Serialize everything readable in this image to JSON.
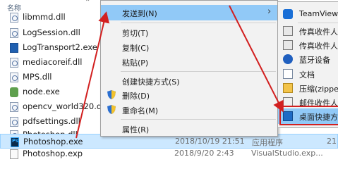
{
  "explorer": {
    "column_name": "名称",
    "files": [
      {
        "name": "libmmd.dll",
        "icon": "dll-icon",
        "date": "",
        "type": "",
        "size": ""
      },
      {
        "name": "LogSession.dll",
        "icon": "dll-icon",
        "date": "",
        "type": "",
        "size": ""
      },
      {
        "name": "LogTransport2.exe",
        "icon": "exe-icon",
        "date": "",
        "type": "",
        "size": ""
      },
      {
        "name": "mediacoreif.dll",
        "icon": "dll-icon",
        "date": "",
        "type": "",
        "size": ""
      },
      {
        "name": "MPS.dll",
        "icon": "dll-icon",
        "date": "",
        "type": "",
        "size": ""
      },
      {
        "name": "node.exe",
        "icon": "node-icon",
        "date": "",
        "type": "",
        "size": ""
      },
      {
        "name": "opencv_world320.dll",
        "icon": "dll-icon",
        "date": "",
        "type": "",
        "size": ""
      },
      {
        "name": "pdfsettings.dll",
        "icon": "dll-icon",
        "date": "",
        "type": "",
        "size": ""
      },
      {
        "name": "Photoshop.dll",
        "icon": "dll-icon",
        "date": "",
        "type": "",
        "size": ""
      },
      {
        "name": "Photoshop.exe",
        "icon": "photoshop-icon",
        "date": "2018/10/19 21:51",
        "type": "应用程序",
        "size": "21"
      },
      {
        "name": "Photoshop.exp",
        "icon": "exp-file-icon",
        "date": "2018/9/20 2:43",
        "type": "VisualStudio.exp...",
        "size": ""
      }
    ]
  },
  "context_menu": {
    "items": [
      {
        "label": "发送到(N)",
        "has_submenu": true,
        "shield": false
      },
      {
        "label": "剪切(T)",
        "has_submenu": false,
        "shield": false
      },
      {
        "label": "复制(C)",
        "has_submenu": false,
        "shield": false
      },
      {
        "label": "粘贴(P)",
        "has_submenu": false,
        "shield": false
      },
      {
        "label": "创建快捷方式(S)",
        "has_submenu": false,
        "shield": false
      },
      {
        "label": "删除(D)",
        "has_submenu": false,
        "shield": true
      },
      {
        "label": "重命名(M)",
        "has_submenu": false,
        "shield": true
      },
      {
        "label": "属性(R)",
        "has_submenu": false,
        "shield": false
      }
    ]
  },
  "send_to_menu": {
    "items": [
      {
        "label": "TeamViewer",
        "icon": "teamviewer-icon"
      },
      {
        "label": "传真收件人",
        "icon": "fax-icon"
      },
      {
        "label": "传真收件人",
        "icon": "fax-icon"
      },
      {
        "label": "蓝牙设备",
        "icon": "bluetooth-icon"
      },
      {
        "label": "文档",
        "icon": "documents-icon"
      },
      {
        "label": "压缩(zipped)",
        "icon": "zip-folder-icon"
      },
      {
        "label": "邮件收件人",
        "icon": "mail-icon"
      },
      {
        "label": "桌面快捷方式",
        "icon": "desktop-shortcut-icon"
      }
    ]
  },
  "colors": {
    "menu_hover": "#91c9f7",
    "selection": "#cce8ff",
    "annotation_red": "#d22020"
  }
}
